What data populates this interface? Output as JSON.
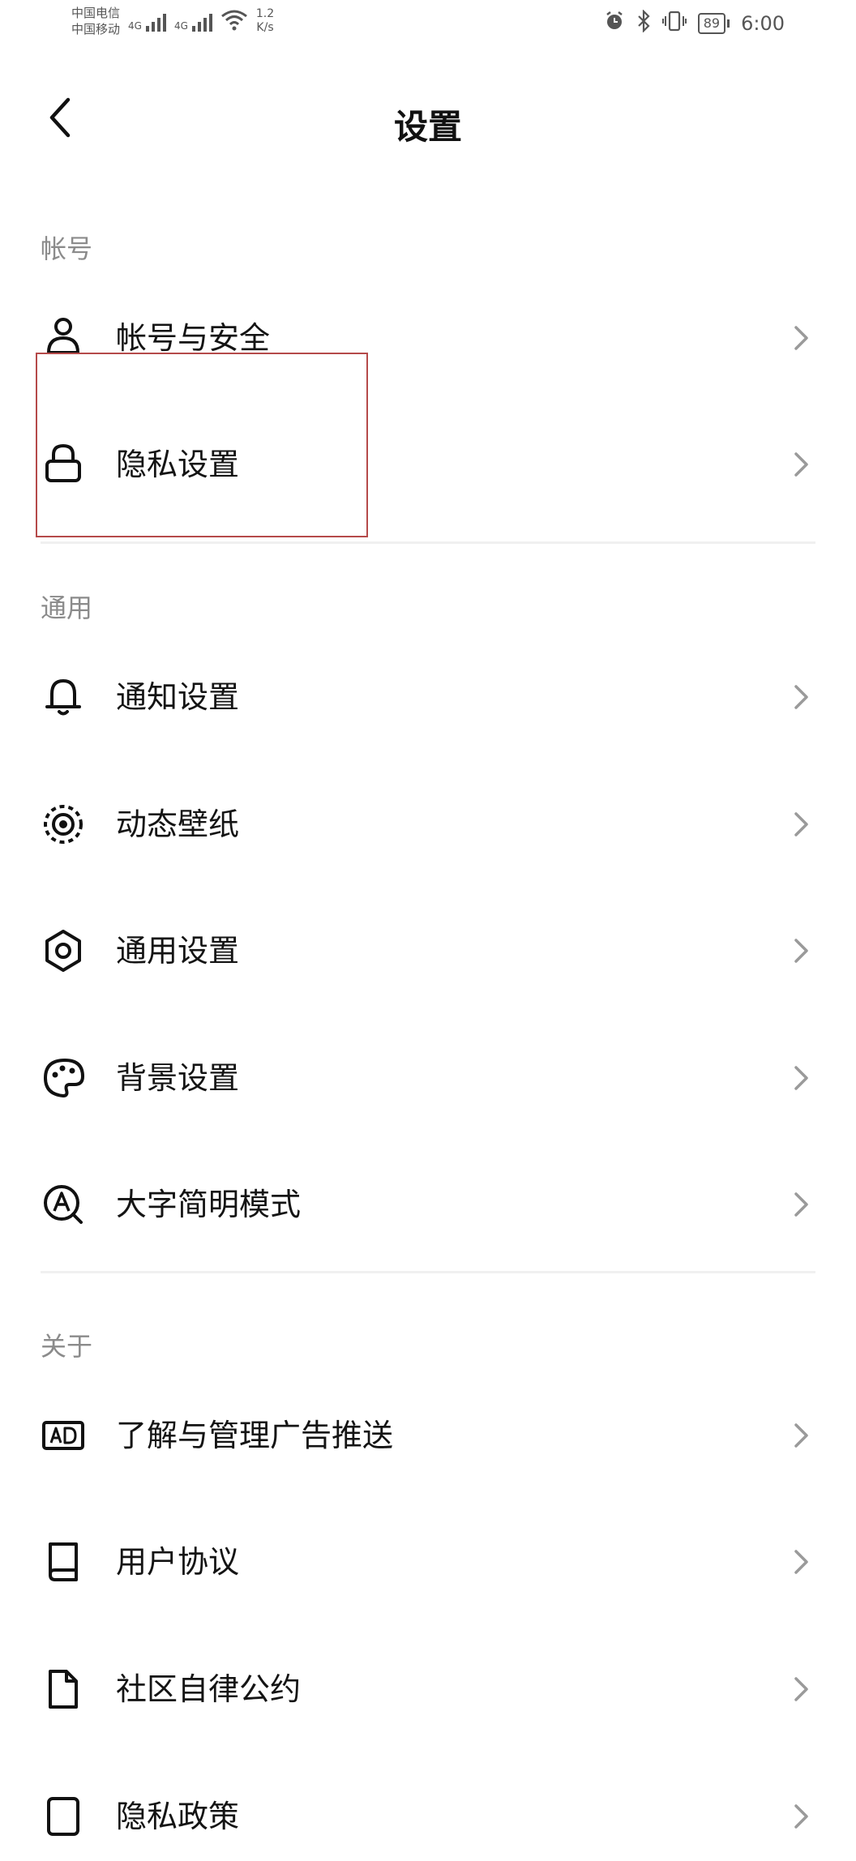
{
  "status_bar": {
    "carrier_1": "中国电信",
    "carrier_2": "中国移动",
    "signal_1_label": "4G",
    "signal_2_label": "4G",
    "net_speed_value": "1.2",
    "net_speed_unit": "K/s",
    "battery": "89",
    "time": "6:00"
  },
  "header": {
    "title": "设置"
  },
  "sections": {
    "account": {
      "title": "帐号",
      "items": [
        {
          "label": "帐号与安全",
          "icon": "user-icon"
        },
        {
          "label": "隐私设置",
          "icon": "lock-icon"
        }
      ]
    },
    "general": {
      "title": "通用",
      "items": [
        {
          "label": "通知设置",
          "icon": "bell-icon"
        },
        {
          "label": "动态壁纸",
          "icon": "live-wallpaper-icon"
        },
        {
          "label": "通用设置",
          "icon": "gear-icon"
        },
        {
          "label": "背景设置",
          "icon": "palette-icon"
        },
        {
          "label": "大字简明模式",
          "icon": "large-font-icon"
        }
      ]
    },
    "about": {
      "title": "关于",
      "items": [
        {
          "label": "了解与管理广告推送",
          "icon": "ad-icon"
        },
        {
          "label": "用户协议",
          "icon": "book-icon"
        },
        {
          "label": "社区自律公约",
          "icon": "document-icon"
        },
        {
          "label": "隐私政策",
          "icon": "privacy-policy-icon"
        }
      ]
    }
  },
  "colors": {
    "background": "#ffffff",
    "text": "#141414",
    "section_header": "#8b8b8b",
    "chevron": "#9a9a9a",
    "divider": "#f0f0f0",
    "highlight_box": "#b54a4a"
  }
}
